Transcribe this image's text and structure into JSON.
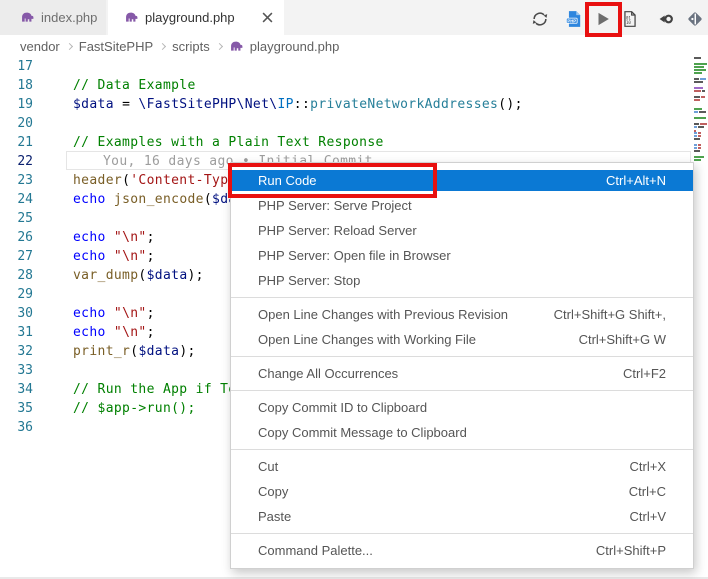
{
  "tabs": [
    {
      "icon": "php",
      "label": "index.php",
      "active": false
    },
    {
      "icon": "php",
      "label": "playground.php",
      "active": true,
      "close": true
    }
  ],
  "toolbar": {
    "buttons": [
      {
        "name": "synchronize-changes"
      },
      {
        "name": "php-server"
      },
      {
        "name": "run-code"
      },
      {
        "name": "binary-file"
      },
      {
        "name": "open-changes"
      },
      {
        "name": "split-editor"
      }
    ]
  },
  "breadcrumb": {
    "items": [
      "vendor",
      "FastSitePHP",
      "scripts",
      "playground.php"
    ]
  },
  "editor": {
    "blame_text": "You, 16 days ago • Initial Commit",
    "lines": [
      {
        "num": 17,
        "tokens": []
      },
      {
        "num": 18,
        "tokens": [
          [
            "c",
            "// Data Example"
          ]
        ]
      },
      {
        "num": 19,
        "tokens": [
          [
            "v",
            "$data"
          ],
          [
            "p",
            " = "
          ],
          [
            "n",
            "\\FastSitePHP\\Net\\"
          ],
          [
            "t",
            "IP"
          ],
          [
            "p",
            "::"
          ],
          [
            "m",
            "privateNetworkAddresses"
          ],
          [
            "p",
            "();"
          ]
        ]
      },
      {
        "num": 20,
        "tokens": []
      },
      {
        "num": 21,
        "tokens": [
          [
            "c",
            "// Examples with a Plain Text Response"
          ]
        ]
      },
      {
        "num": 22,
        "blame": true,
        "tokens": []
      },
      {
        "num": 23,
        "tokens": [
          [
            "f",
            "header"
          ],
          [
            "p",
            "("
          ],
          [
            "s",
            "'Content-Typ"
          ]
        ]
      },
      {
        "num": 24,
        "tokens": [
          [
            "k",
            "echo"
          ],
          [
            "p",
            " "
          ],
          [
            "f",
            "json_encode"
          ],
          [
            "p",
            "("
          ],
          [
            "v",
            "$da"
          ]
        ]
      },
      {
        "num": 25,
        "tokens": []
      },
      {
        "num": 26,
        "tokens": [
          [
            "k",
            "echo"
          ],
          [
            "p",
            " "
          ],
          [
            "s",
            "\"\\n\""
          ],
          [
            "p",
            ";"
          ]
        ]
      },
      {
        "num": 27,
        "tokens": [
          [
            "k",
            "echo"
          ],
          [
            "p",
            " "
          ],
          [
            "s",
            "\"\\n\""
          ],
          [
            "p",
            ";"
          ]
        ]
      },
      {
        "num": 28,
        "tokens": [
          [
            "f",
            "var_dump"
          ],
          [
            "p",
            "("
          ],
          [
            "v",
            "$data"
          ],
          [
            "p",
            ");"
          ]
        ]
      },
      {
        "num": 29,
        "tokens": []
      },
      {
        "num": 30,
        "tokens": [
          [
            "k",
            "echo"
          ],
          [
            "p",
            " "
          ],
          [
            "s",
            "\"\\n\""
          ],
          [
            "p",
            ";"
          ]
        ]
      },
      {
        "num": 31,
        "tokens": [
          [
            "k",
            "echo"
          ],
          [
            "p",
            " "
          ],
          [
            "s",
            "\"\\n\""
          ],
          [
            "p",
            ";"
          ]
        ]
      },
      {
        "num": 32,
        "tokens": [
          [
            "f",
            "print_r"
          ],
          [
            "p",
            "("
          ],
          [
            "v",
            "$data"
          ],
          [
            "p",
            ");"
          ]
        ]
      },
      {
        "num": 33,
        "tokens": []
      },
      {
        "num": 34,
        "tokens": [
          [
            "c",
            "// Run the App if Te"
          ]
        ]
      },
      {
        "num": 35,
        "tokens": [
          [
            "c",
            "// $app->run();"
          ]
        ]
      },
      {
        "num": 36,
        "tokens": []
      }
    ]
  },
  "context_menu": {
    "items": [
      {
        "label": "Run Code",
        "shortcut": "Ctrl+Alt+N",
        "highlighted": true
      },
      {
        "label": "PHP Server: Serve Project"
      },
      {
        "label": "PHP Server: Reload Server"
      },
      {
        "label": "PHP Server: Open file in Browser"
      },
      {
        "label": "PHP Server: Stop"
      },
      {
        "type": "separator"
      },
      {
        "label": "Open Line Changes with Previous Revision",
        "shortcut": "Ctrl+Shift+G Shift+,"
      },
      {
        "label": "Open Line Changes with Working File",
        "shortcut": "Ctrl+Shift+G W"
      },
      {
        "type": "separator"
      },
      {
        "label": "Change All Occurrences",
        "shortcut": "Ctrl+F2"
      },
      {
        "type": "separator"
      },
      {
        "label": "Copy Commit ID to Clipboard"
      },
      {
        "label": "Copy Commit Message to Clipboard"
      },
      {
        "type": "separator"
      },
      {
        "label": "Cut",
        "shortcut": "Ctrl+X"
      },
      {
        "label": "Copy",
        "shortcut": "Ctrl+C"
      },
      {
        "label": "Paste",
        "shortcut": "Ctrl+V"
      },
      {
        "type": "separator"
      },
      {
        "label": "Command Palette...",
        "shortcut": "Ctrl+Shift+P"
      }
    ]
  },
  "minimap": {
    "rows": [
      [
        [
          "d",
          7
        ]
      ],
      [],
      [
        [
          "g",
          13
        ]
      ],
      [
        [
          "g",
          10
        ]
      ],
      [
        [
          "g",
          12
        ]
      ],
      [
        [
          "g",
          8
        ]
      ],
      [],
      [
        [
          "d",
          5
        ],
        [
          "b",
          6
        ]
      ],
      [
        [
          "d",
          9
        ]
      ],
      [],
      [
        [
          "p",
          9
        ]
      ],
      [
        [
          "r",
          7
        ],
        [
          "d",
          3
        ]
      ],
      [],
      [
        [
          "d",
          6
        ],
        [
          "r",
          4
        ]
      ],
      [
        [
          "r",
          6
        ]
      ],
      [],
      [],
      [
        [
          "g",
          8
        ]
      ],
      [
        [
          "b",
          4
        ],
        [
          "d",
          7
        ],
        [
          "r",
          2
        ]
      ],
      [],
      [
        [
          "g",
          12
        ]
      ],
      [],
      [
        [
          "d",
          5
        ],
        [
          "r",
          7
        ]
      ],
      [
        [
          "b",
          3
        ],
        [
          "d",
          6
        ]
      ],
      [],
      [
        [
          "b",
          3
        ],
        [
          "r",
          3
        ]
      ],
      [
        [
          "b",
          3
        ],
        [
          "r",
          3
        ]
      ],
      [
        [
          "d",
          6
        ]
      ],
      [],
      [
        [
          "b",
          3
        ],
        [
          "r",
          3
        ]
      ],
      [
        [
          "b",
          3
        ],
        [
          "r",
          3
        ]
      ],
      [
        [
          "d",
          6
        ]
      ],
      [],
      [
        [
          "g",
          10
        ]
      ],
      [
        [
          "g",
          7
        ]
      ],
      []
    ]
  },
  "colors": {
    "accent_blue": "#0b79d4",
    "highlight_red": "#e81010",
    "comment": "#008000",
    "keyword": "#0000ff",
    "string": "#a31515",
    "function": "#795e26",
    "variable": "#001080",
    "namespace": "#001080",
    "classname": "#0070c1",
    "method": "#267f99",
    "line_number": "#237893",
    "active_line_number": "#0b216f",
    "blame": "#9d9d9d",
    "minimap_green": "#4ea24e",
    "minimap_dark": "#5a5a5a",
    "minimap_red": "#c06060",
    "minimap_blue": "#6f9fd8",
    "minimap_purple": "#a06cc8"
  }
}
